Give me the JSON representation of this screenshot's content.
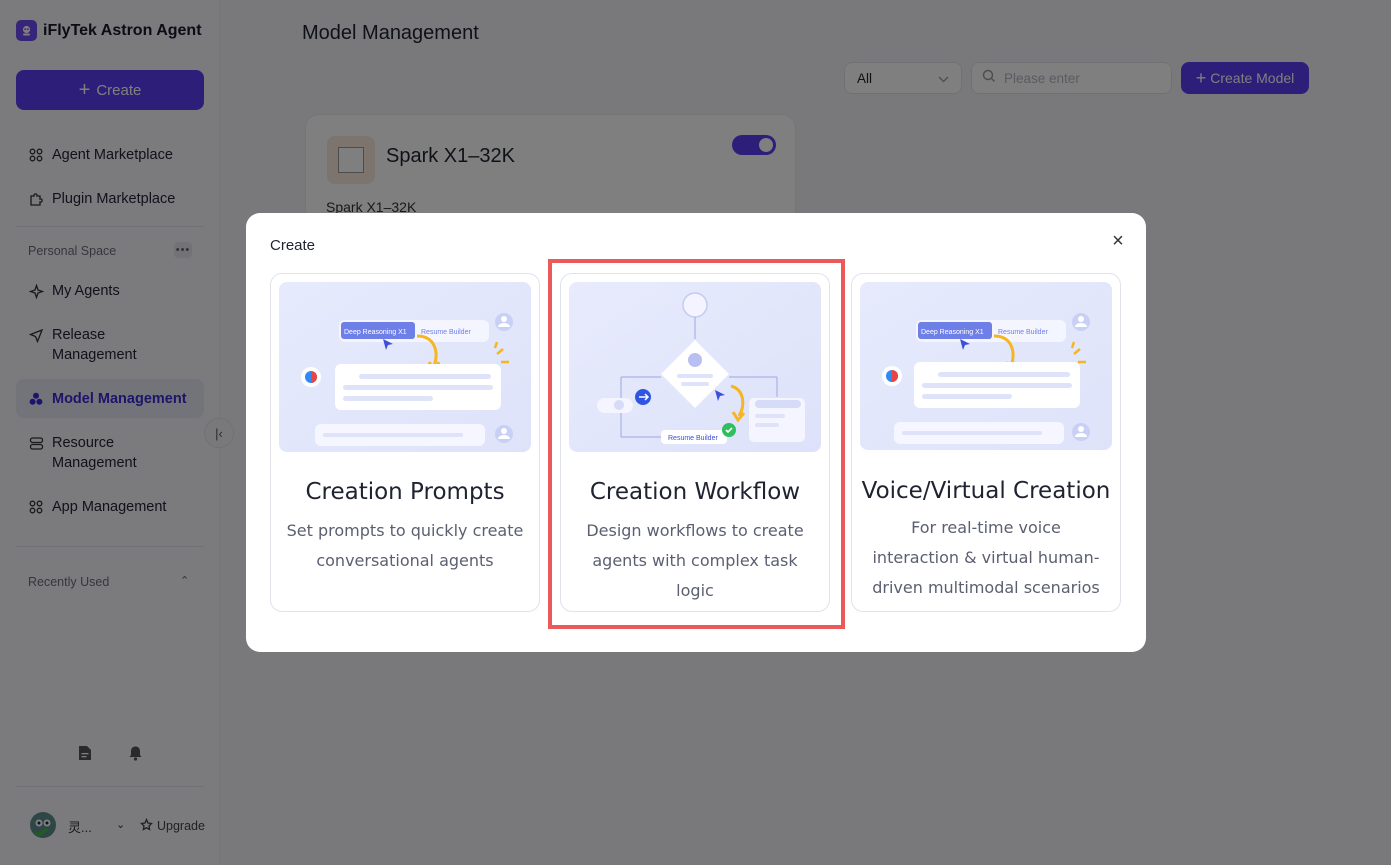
{
  "brand": {
    "name": "iFlyTek Astron Agent"
  },
  "sidebar": {
    "create_label": "Create",
    "items": [
      {
        "label": "Agent Marketplace",
        "icon": "grid-icon"
      },
      {
        "label": "Plugin Marketplace",
        "icon": "puzzle-icon"
      }
    ],
    "personal_space_label": "Personal Space",
    "personal_items": [
      {
        "label": "My Agents",
        "icon": "sparkle-icon"
      },
      {
        "label": "Release Management",
        "icon": "send-icon"
      },
      {
        "label": "Model Management",
        "icon": "cube-icon",
        "active": true
      },
      {
        "label": "Resource Management",
        "icon": "database-icon"
      },
      {
        "label": "App Management",
        "icon": "grid-icon"
      }
    ],
    "recently_used_label": "Recently Used",
    "user": {
      "name": "灵...",
      "upgrade_label": "Upgrade"
    }
  },
  "main": {
    "title": "Model Management",
    "filter": {
      "selected": "All"
    },
    "search": {
      "placeholder": "Please enter"
    },
    "create_model_label": "Create Model",
    "model_card": {
      "title": "Spark X1–32K",
      "description": "Spark X1–32K",
      "enabled": true
    }
  },
  "modal": {
    "title": "Create",
    "options": [
      {
        "title": "Creation Prompts",
        "description": "Set prompts to quickly create conversational agents"
      },
      {
        "title": "Creation Workflow",
        "description": "Design workflows to create agents with complex task logic",
        "highlighted": true
      },
      {
        "title": "Voice/Virtual Creation",
        "description": "For real-time voice interaction & virtual human-driven multimodal scenarios"
      }
    ],
    "illustration_text": {
      "deep_reasoning": "Deep Reasoning X1",
      "resume_builder": "Resume Builder"
    }
  },
  "colors": {
    "accent": "#5b3df4",
    "highlight_border": "#ea5a5a"
  }
}
